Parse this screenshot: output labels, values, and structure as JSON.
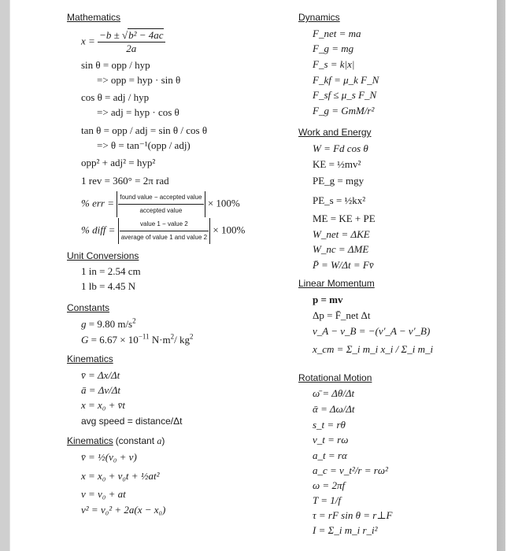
{
  "left_column": {
    "mathematics": {
      "heading": "Mathematics",
      "quadratic": {
        "lhs": "x =",
        "numerator_a": "−b ± ",
        "radical_sign": "√",
        "radicand": "b² − 4ac",
        "denominator": "2a"
      },
      "sin_def": "sin θ = opp / hyp",
      "sin_solve": "=>  opp = hyp · sin θ",
      "cos_def": "cos θ = adj / hyp",
      "cos_solve": "=>  adj = hyp · cos θ",
      "tan_def": "tan θ = opp / adj = sin θ / cos θ",
      "tan_solve": "=>  θ = tan⁻¹(opp / adj)",
      "pythagoras": "opp² + adj² = hyp²",
      "revolution": "1 rev = 360° = 2π rad",
      "percent_error": {
        "lhs": "% err =",
        "numerator": "found value − accepted value",
        "denominator": "accepted value",
        "rhs": "× 100%"
      },
      "percent_diff": {
        "lhs": "% diff =",
        "numerator": "value 1 − value 2",
        "denominator": "average of value 1 and value 2",
        "rhs": "× 100%"
      }
    },
    "unit_conversions": {
      "heading": "Unit Conversions",
      "items": [
        "1 in = 2.54 cm",
        "1 lb = 4.45 N"
      ]
    },
    "constants": {
      "heading": "Constants",
      "g": {
        "symbol": "g",
        "value": " = 9.80 m/s",
        "exp": "2"
      },
      "G": {
        "symbol": "G",
        "value": " = 6.67 × 10",
        "exp": "−11",
        "unit": " N·m",
        "unit_exp": "2",
        "unit2": "/ kg",
        "unit2_exp": "2"
      }
    },
    "kinematics": {
      "heading": "Kinematics",
      "items": [
        "v̄ = Δx/Δt",
        "ā = Δv/Δt",
        "x = x₀ + v̄t",
        "avg speed = distance/Δt"
      ]
    },
    "kinematics_const": {
      "heading": "Kinematics",
      "heading_suffix": "(constant ",
      "heading_var": "a",
      "heading_close": ")",
      "items": [
        "v̄ = ½(v₀ + v)",
        "x = x₀ + v₀t + ½at²",
        "v = v₀ + at",
        "v² = v₀² + 2a(x − x₀)"
      ]
    }
  },
  "right_column": {
    "dynamics": {
      "heading": "Dynamics",
      "items": [
        "F_net = ma",
        "F_g = mg",
        "F_s = k|x|",
        "F_kf = μ_k F_N",
        "F_sf ≤ μ_s F_N",
        "F_g = GmM/r²"
      ]
    },
    "work_energy": {
      "heading": "Work and Energy",
      "items": [
        "W = Fd cos θ",
        "KE = ½mv²",
        "PE_g = mgy",
        "PE_s = ½kx²",
        "ME = KE + PE",
        "W_net = ΔKE",
        "W_nc = ΔME",
        "P̄ = W/Δt = Fv̄"
      ]
    },
    "linear_momentum": {
      "heading": "Linear Momentum",
      "items": [
        "p = mv",
        "Δp = F̄_net Δt",
        "v_A − v_B = −(v′_A − v′_B)",
        "x_cm = Σ_i m_i x_i / Σ_i m_i"
      ]
    },
    "rotational_motion": {
      "heading": "Rotational Motion",
      "items": [
        "ω̄ = Δθ/Δt",
        "ᾱ = Δω/Δt",
        "s_t = rθ",
        "v_t = rω",
        "a_t = rα",
        "a_c = v_t²/r = rω²",
        "ω = 2πf",
        "T = 1/f",
        "τ = rF sin θ = r⊥F",
        "I = Σ_i m_i r_i²"
      ]
    }
  }
}
